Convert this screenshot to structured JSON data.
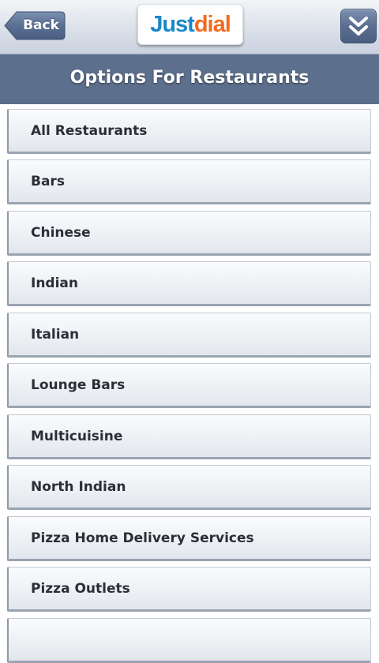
{
  "header": {
    "back_label": "Back",
    "logo_just": "Just",
    "logo_dial": "dial",
    "menu_icon": "double-chevron-down-icon"
  },
  "title": "Options For Restaurants",
  "colors": {
    "title_bar": "#5c6f8c",
    "logo_blue": "#1a86c8",
    "logo_orange": "#f26b21",
    "item_text": "#2a2f37"
  },
  "list": {
    "items": [
      {
        "label": "All Restaurants"
      },
      {
        "label": "Bars"
      },
      {
        "label": "Chinese"
      },
      {
        "label": "Indian"
      },
      {
        "label": "Italian"
      },
      {
        "label": "Lounge Bars"
      },
      {
        "label": "Multicuisine"
      },
      {
        "label": "North Indian"
      },
      {
        "label": "Pizza Home Delivery Services"
      },
      {
        "label": "Pizza Outlets"
      },
      {
        "label": ""
      }
    ]
  }
}
